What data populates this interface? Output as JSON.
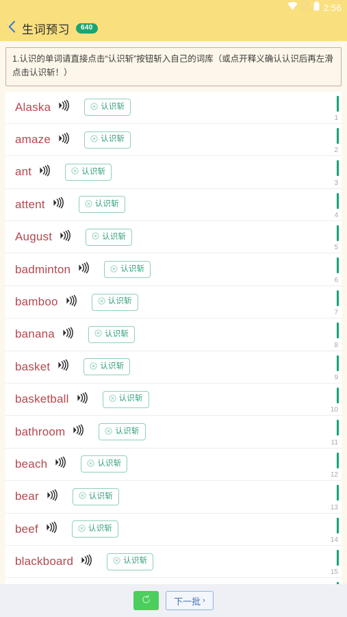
{
  "status_bar": {
    "time": "2:56",
    "icons": [
      "wifi-icon",
      "no-sim-icon",
      "battery-icon"
    ]
  },
  "header": {
    "back_icon": "chevron-left-icon",
    "title": "生词预习",
    "badge_count": "640",
    "background_color": "#fadf7f",
    "badge_color": "#1aa571"
  },
  "notice": {
    "text": "1.认识的单词请直接点击“认识斩”按钮斩入自己的词库（或点开释义确认认识后再左滑点击认识斩！）"
  },
  "list": {
    "button_label": "认识斩",
    "button_icon": "circle-x-icon",
    "sound_icon": "sound-wave-icon",
    "word_color": "#b5474f",
    "accent_color": "#13a570",
    "items": [
      {
        "word": "Alaska",
        "index": "1"
      },
      {
        "word": "amaze",
        "index": "2"
      },
      {
        "word": "ant",
        "index": "3"
      },
      {
        "word": "attent",
        "index": "4"
      },
      {
        "word": "August",
        "index": "5"
      },
      {
        "word": "badminton",
        "index": "6"
      },
      {
        "word": "bamboo",
        "index": "7"
      },
      {
        "word": "banana",
        "index": "8"
      },
      {
        "word": "basket",
        "index": "9"
      },
      {
        "word": "basketball",
        "index": "10"
      },
      {
        "word": "bathroom",
        "index": "11"
      },
      {
        "word": "beach",
        "index": "12"
      },
      {
        "word": "bear",
        "index": "13"
      },
      {
        "word": "beef",
        "index": "14"
      },
      {
        "word": "blackboard",
        "index": "15"
      },
      {
        "word": "",
        "index": ""
      }
    ]
  },
  "bottom_bar": {
    "refresh_icon": "refresh-icon",
    "refresh_color": "#4cce5d",
    "next_label": "下一批",
    "next_chevron": "›",
    "next_color": "#3f72b5"
  }
}
